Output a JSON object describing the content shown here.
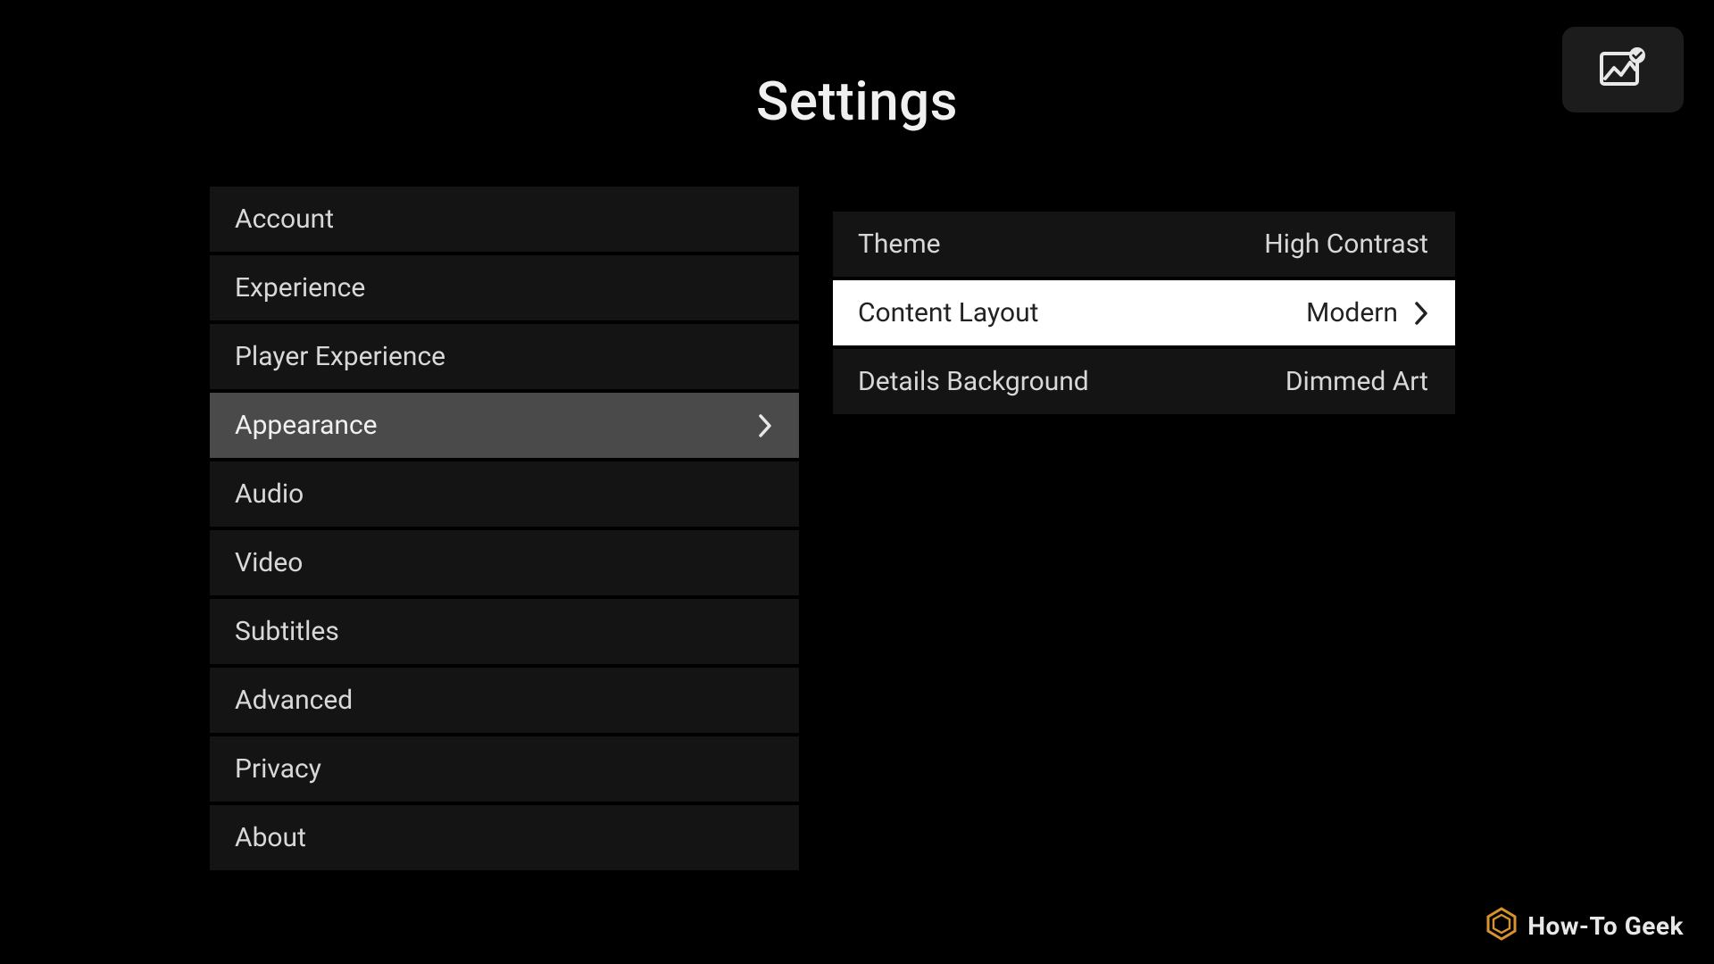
{
  "title": "Settings",
  "sidebar": {
    "items": [
      {
        "label": "Account",
        "selected": false
      },
      {
        "label": "Experience",
        "selected": false
      },
      {
        "label": "Player Experience",
        "selected": false
      },
      {
        "label": "Appearance",
        "selected": true
      },
      {
        "label": "Audio",
        "selected": false
      },
      {
        "label": "Video",
        "selected": false
      },
      {
        "label": "Subtitles",
        "selected": false
      },
      {
        "label": "Advanced",
        "selected": false
      },
      {
        "label": "Privacy",
        "selected": false
      },
      {
        "label": "About",
        "selected": false
      }
    ]
  },
  "detail": {
    "rows": [
      {
        "label": "Theme",
        "value": "High Contrast",
        "focused": false,
        "chevron": false
      },
      {
        "label": "Content Layout",
        "value": "Modern",
        "focused": true,
        "chevron": true
      },
      {
        "label": "Details Background",
        "value": "Dimmed Art",
        "focused": false,
        "chevron": false
      }
    ]
  },
  "watermark": {
    "text": "How-To Geek"
  }
}
